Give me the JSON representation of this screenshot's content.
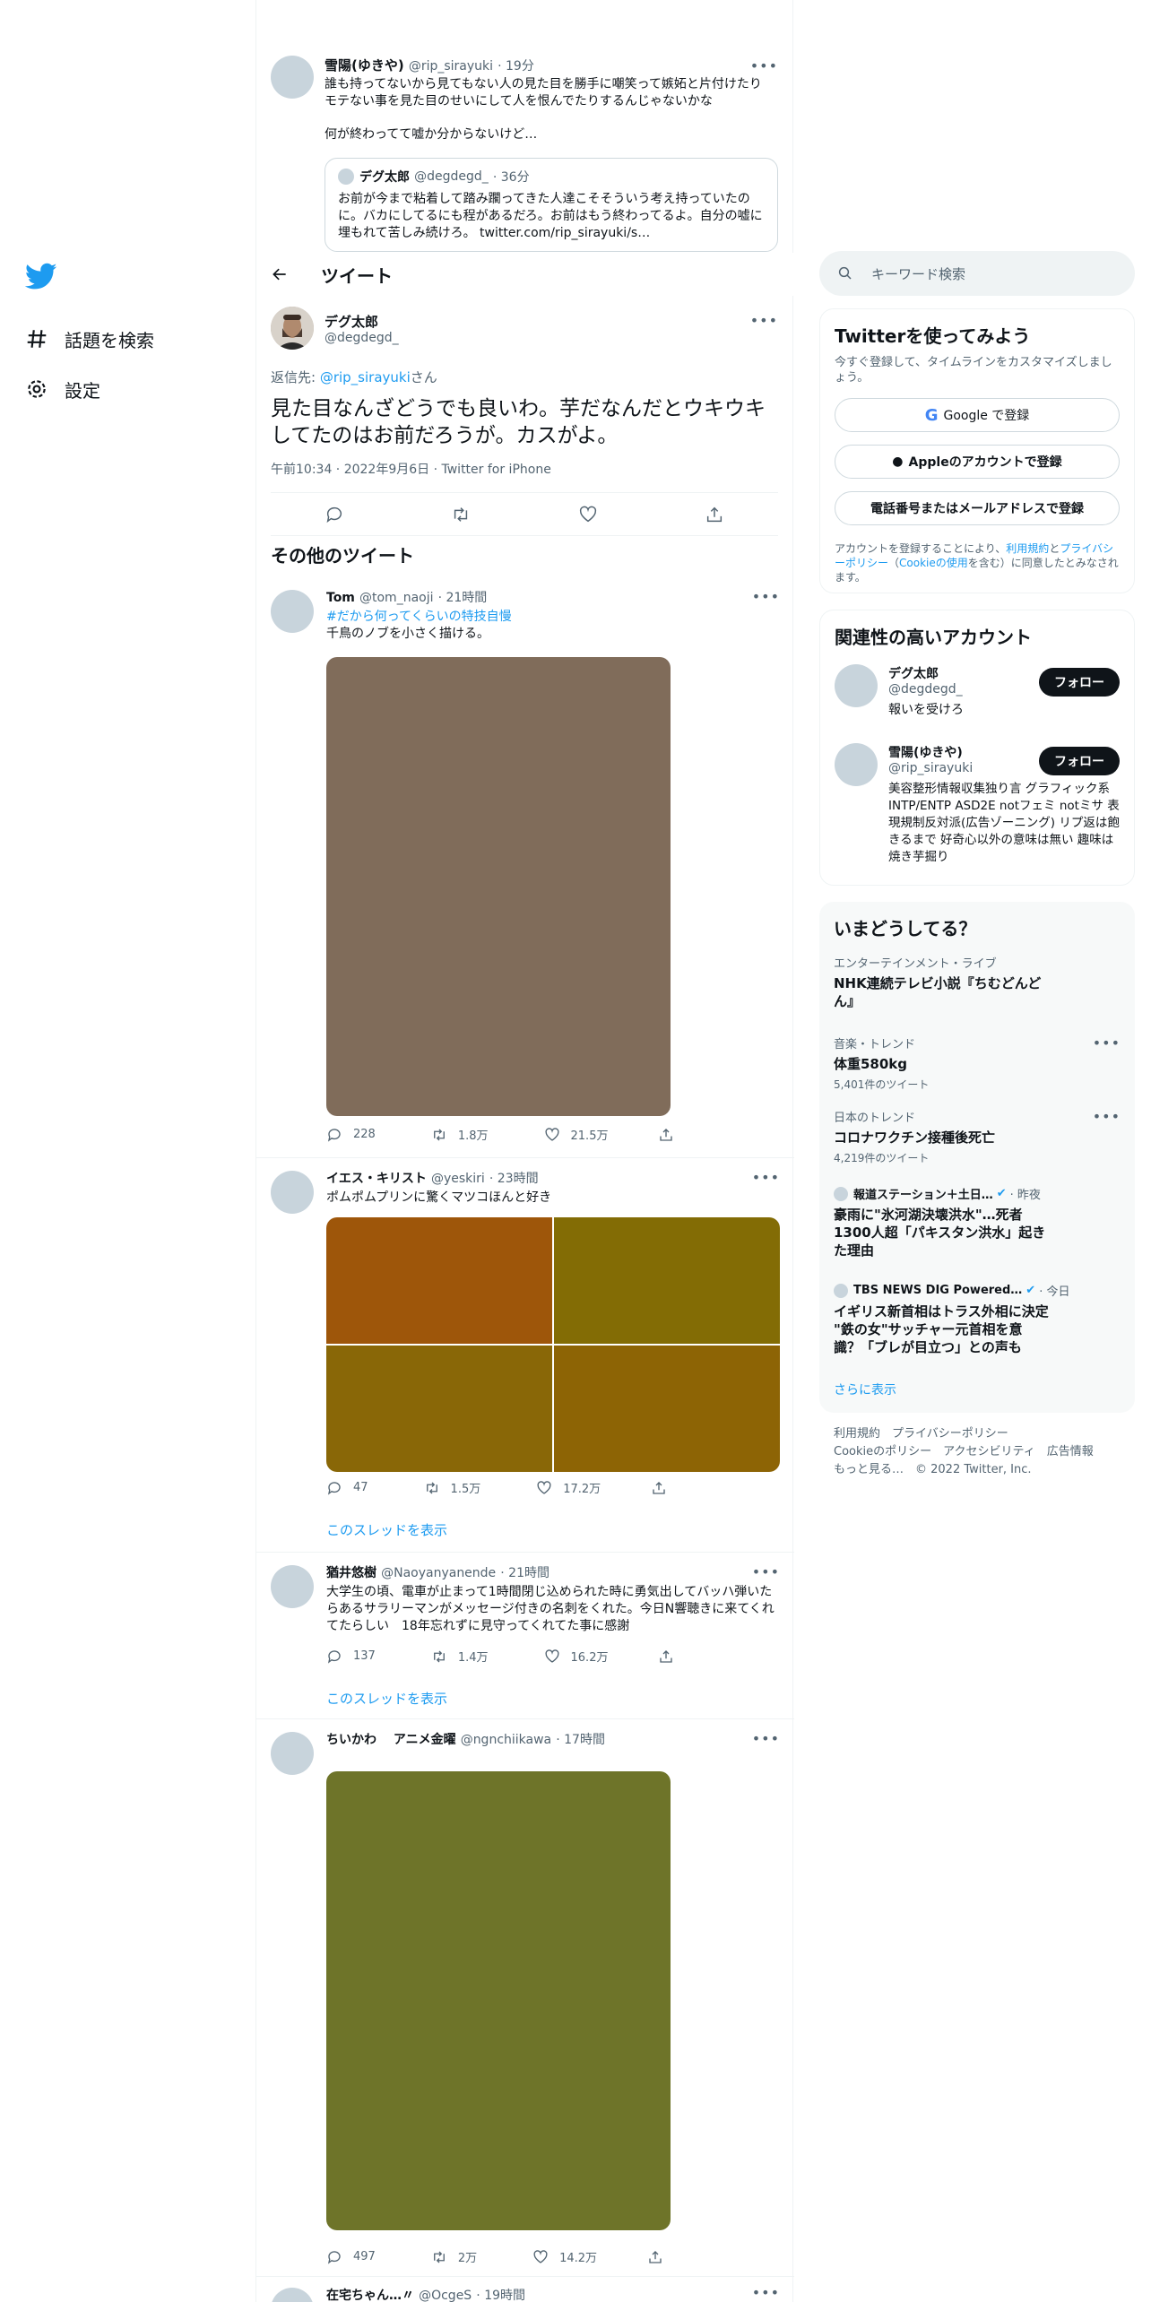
{
  "nav": {
    "explore": "話題を検索",
    "settings": "設定"
  },
  "prev_tweet": {
    "name": "雪陽(ゆきや)",
    "handle": "@rip_sirayuki",
    "time": "· 19分",
    "text1": "誰も持ってないから見てもない人の見た目を勝手に嘲笑って嫉妬と片付けたり モテない事を見た目のせいにして人を恨んでたりするんじゃないかな",
    "text2": "何が終わってて嘘か分からないけど…",
    "quote_name": "デグ太郎",
    "quote_handle": "@degdegd_",
    "quote_time": "· 36分",
    "quote_text": "お前が今まで粘着して踏み躙ってきた人達こそそういう考え持っていたのに。バカにしてるにも程があるだろ。お前はもう終わってるよ。自分の嘘に埋もれて苦しみ続けろ。 twitter.com/rip_sirayuki/s…"
  },
  "header": {
    "title": "ツイート"
  },
  "main_tweet": {
    "name": "デグ太郎",
    "handle": "@degdegd_",
    "reply_prefix": "返信先: ",
    "reply_to": "@rip_sirayuki",
    "reply_suffix": "さん",
    "text": "見た目なんざどうでも良いわ。芋だなんだとウキウキしてたのはお前だろうが。カスがよ。",
    "meta": "午前10:34 · 2022年9月6日 · Twitter for iPhone"
  },
  "more_tweets_title": "その他のツイート",
  "tweets": [
    {
      "name": "Tom",
      "handle": "@tom_naoji",
      "time": "· 21時間",
      "hashtag": "#だから何って",
      "hashtag2": "くらいの特技自慢",
      "text": "千鳥のノブを小さく描ける。",
      "replies": "228",
      "retweets": "1.8万",
      "likes": "21.5万",
      "media_color": "#806c5a"
    },
    {
      "name": "イエス・キリスト",
      "handle": "@yeskiri",
      "time": "· 23時間",
      "text": "ポムポムプリンに驚くマツコほんと好き",
      "replies": "47",
      "retweets": "1.5万",
      "likes": "17.2万",
      "thread": "このスレッドを表示",
      "grid": [
        "#9e560a",
        "#836c05",
        "#896707",
        "#8d6405"
      ]
    },
    {
      "name": "猶井悠樹",
      "handle": "@Naoyanyanende",
      "time": "· 21時間",
      "text": "大学生の頃、電車が止まって1時間閉じ込められた時に勇気出してバッハ弾いたらあるサラリーマンがメッセージ付きの名刺をくれた。今日N響聴きに来てくれてたらしい　18年忘れずに見守ってくれてた事に感謝",
      "replies": "137",
      "retweets": "1.4万",
      "likes": "16.2万",
      "thread": "このスレッドを表示"
    },
    {
      "name": "ちいかわ　 アニメ金曜",
      "handle": "@ngnchiikawa",
      "time": "· 17時間",
      "replies": "497",
      "retweets": "2万",
      "likes": "14.2万",
      "media_color": "#6e7429"
    },
    {
      "name": "在宅ちゃん…〃",
      "handle": "@OcgeS",
      "time": "· 19時間"
    }
  ],
  "right": {
    "search_placeholder": "キーワード検索",
    "signup": {
      "title": "Twitterを使ってみよう",
      "desc": "今すぐ登録して、タイムラインをカスタマイズしましょう。",
      "google": "Google で登録",
      "apple": "Appleのアカウントで登録",
      "phone": "電話番号またはメールアドレスで登録",
      "terms_pre": "アカウントを登録することにより、",
      "terms_link": "利用規約",
      "terms_mid": "と",
      "privacy_link": "プライバシーポリシー",
      "cookie_pre": "（",
      "cookie_link": "Cookieの使用",
      "terms_post": "を含む）に同意したとみなされます。"
    },
    "related": {
      "title": "関連性の高いアカウント",
      "follow": "フォロー",
      "accounts": [
        {
          "name": "デグ太郎",
          "handle": "@degdegd_",
          "bio": "報いを受けろ"
        },
        {
          "name": "雪陽(ゆきや)",
          "handle": "@rip_sirayuki",
          "bio": "美容整形情報収集独り言 グラフィック系 INTP/ENTP ASD2E notフェミ notミサ 表現規制反対派(広告ゾーニング) リプ返は飽きるまで 好奇心以外の意味は無い 趣味は焼き芋掘り"
        }
      ]
    },
    "trends": {
      "title": "いまどうしてる？",
      "items": [
        {
          "cat": "エンターテインメント・ライブ",
          "t": "NHK連続テレビ小説『ちむどんどん』"
        },
        {
          "cat": "音楽・トレンド",
          "t": "体重580kg",
          "count": "5,401件のツイート"
        },
        {
          "cat": "日本のトレンド",
          "t": "コロナワクチン接種後死亡",
          "count": "4,219件のツイート"
        },
        {
          "src": "報道ステーション＋土日…",
          "when": "· 昨夜",
          "t": "豪雨に\"氷河湖決壊洪水\"…死者1300人超「パキスタン洪水」起きた理由"
        },
        {
          "src": "TBS NEWS DIG Powered…",
          "when": "· 今日",
          "t": "イギリス新首相はトラス外相に決定 \"鉄の女\"サッチャー元首相を意識？「ブレが目立つ」との声も"
        }
      ],
      "more": "さらに表示"
    },
    "footer": {
      "l1": "利用規約　プライバシーポリシー",
      "l2": "Cookieのポリシー　アクセシビリティ　広告情報",
      "l3": "もっと見る…　© 2022 Twitter, Inc."
    }
  },
  "colors": {
    "accent": "#1d9bf0",
    "text": "#0f1419",
    "muted": "#536471"
  }
}
